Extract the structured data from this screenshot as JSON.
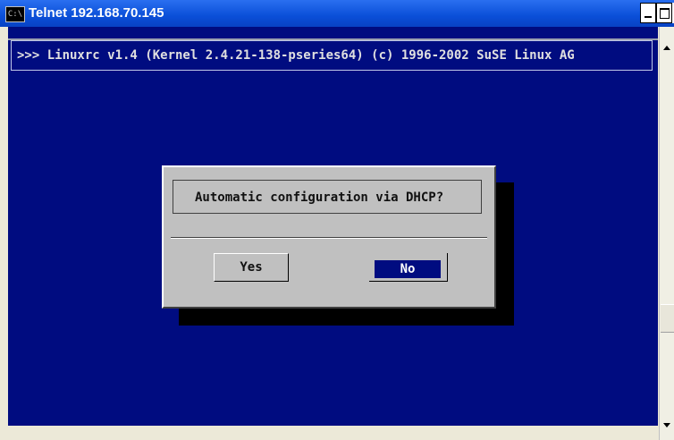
{
  "window": {
    "title": "Telnet 192.168.70.145",
    "icon_text": "C:\\"
  },
  "console": {
    "banner": ">>> Linuxrc v1.4 (Kernel 2.4.21-138-pseries64) (c) 1996-2002 SuSE Linux AG"
  },
  "dialog": {
    "question": "Automatic configuration via DHCP?",
    "yes_label": "Yes",
    "no_label": "No",
    "selected": "No"
  },
  "colors": {
    "console_bg": "#000c80",
    "dialog_bg": "#c0c0c0",
    "titlebar": "#0a4fd8"
  }
}
